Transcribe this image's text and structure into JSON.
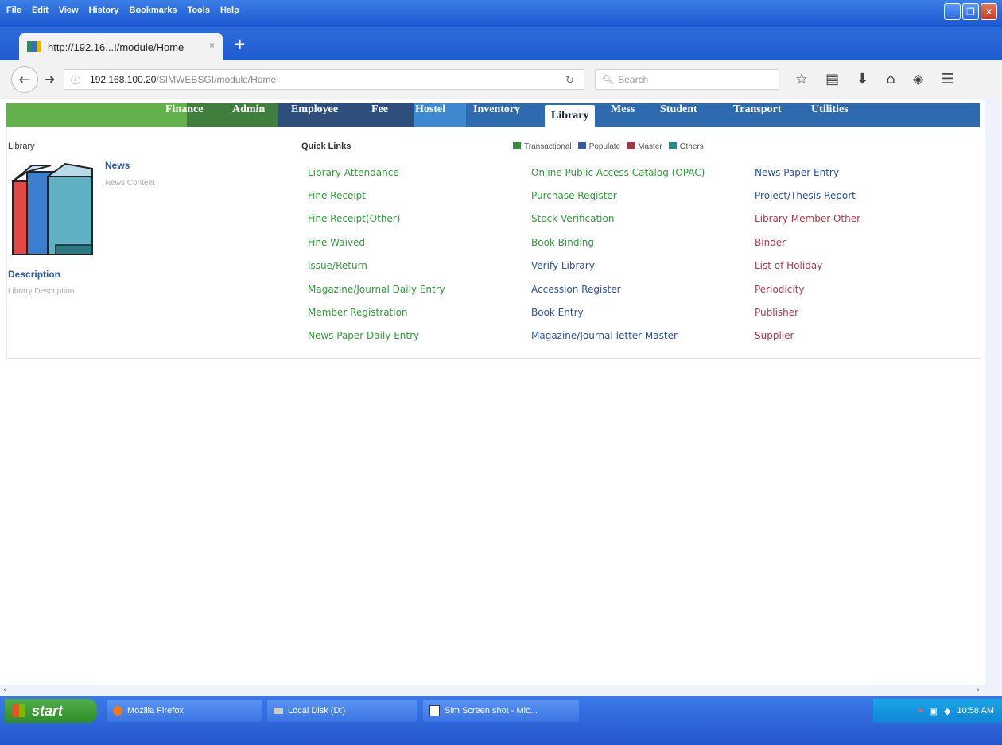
{
  "window": {
    "menu": [
      "File",
      "Edit",
      "View",
      "History",
      "Bookmarks",
      "Tools",
      "Help"
    ],
    "tab_title": "http://192.16...I/module/Home",
    "tab_close": "×",
    "new_tab": "+"
  },
  "navbar": {
    "url_host": "192.168.100.20",
    "url_path": "/SIMWEBSGI/module/Home",
    "search_placeholder": "Search"
  },
  "modules": [
    "Finance",
    "Admin",
    "Employee",
    "Fee",
    "Hostel",
    "Inventory",
    "Library",
    "Mess",
    "Student",
    "Transport",
    "Utilities"
  ],
  "active_module": "Library",
  "page": {
    "heading": "Library",
    "news_title": "News",
    "news_content": "News Content",
    "description_title": "Description",
    "description_text": "Library Description",
    "quick_links_title": "Quick Links"
  },
  "legend": [
    {
      "label": "Transactional",
      "color": "#3a8a3e"
    },
    {
      "label": "Populate",
      "color": "#3b56a4"
    },
    {
      "label": "Master",
      "color": "#9b3a45"
    },
    {
      "label": "Others",
      "color": "#2c8a86"
    }
  ],
  "links": {
    "col1": [
      "Library Attendance",
      "Fine Receipt",
      "Fine Receipt(Other)",
      "Fine Waived",
      "Issue/Return",
      "Magazine/Journal Daily Entry",
      "Member Registration",
      "News Paper Daily Entry"
    ],
    "col2": [
      "Online Public Access Catalog (OPAC)",
      "Purchase Register",
      "Stock Verification",
      "Book Binding",
      "Verify Library",
      "Accession Register",
      "Book Entry",
      "Magazine/Journal letter Master"
    ],
    "col3": [
      "News Paper Entry",
      "Project/Thesis Report",
      "Library Member Other",
      "Binder",
      "List of Holiday",
      "Periodicity",
      "Publisher",
      "Supplier"
    ]
  },
  "taskbar": {
    "start": "start",
    "tasks": [
      "Mozilla Firefox",
      "Local Disk (D:)",
      "Sim Screen shot - Mic..."
    ],
    "clock": "10:58 AM"
  }
}
